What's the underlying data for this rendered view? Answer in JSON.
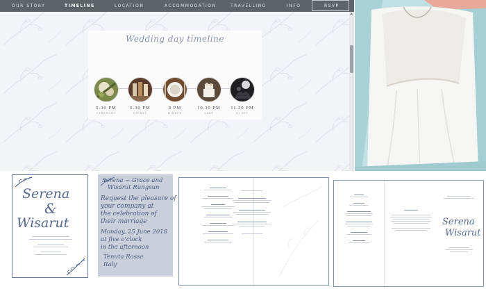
{
  "nav": {
    "items": [
      {
        "label": "OUR STORY",
        "active": false
      },
      {
        "label": "TIMELINE",
        "active": true
      },
      {
        "label": "LOCATION",
        "active": false
      },
      {
        "label": "ACCOMMODATION",
        "active": false
      },
      {
        "label": "TRAVELLING",
        "active": false
      },
      {
        "label": "INFO",
        "active": false
      }
    ],
    "rsvp_label": "RSVP"
  },
  "timeline": {
    "title": "Wedding day timeline",
    "events": [
      {
        "time": "5.30 PM",
        "label": "CEREMONY",
        "icon": "ceremony-photo"
      },
      {
        "time": "6.30 PM",
        "label": "DRINKS",
        "icon": "drinks-photo"
      },
      {
        "time": "8 PM",
        "label": "DINNER",
        "icon": "dinner-photo"
      },
      {
        "time": "10.30 PM",
        "label": "CAKE",
        "icon": "cake-photo"
      },
      {
        "time": "11.30 PM",
        "label": "DJ SET",
        "icon": "dj-photo"
      }
    ]
  },
  "invite": {
    "name1": "Serena",
    "amp": "&",
    "name2": "Wisarut"
  },
  "handwritten": {
    "line1": "Serena ~ Grace and",
    "line2": "Wisarut Rungsun",
    "line3": "Request the pleasure of",
    "line4": "your company at",
    "line5": "the celebration of",
    "line6": "their marriage",
    "line7": "Monday, 25 June 2018",
    "line8": "at five o'clock",
    "line9": "in the afternoon",
    "line10": "Tenuta Rossa",
    "line11": "Italy"
  },
  "menu2": {
    "signature1": "Serena",
    "signature2": "Wisarut"
  },
  "colors": {
    "nav_bg": "#5e6269",
    "ink": "#56688e"
  }
}
